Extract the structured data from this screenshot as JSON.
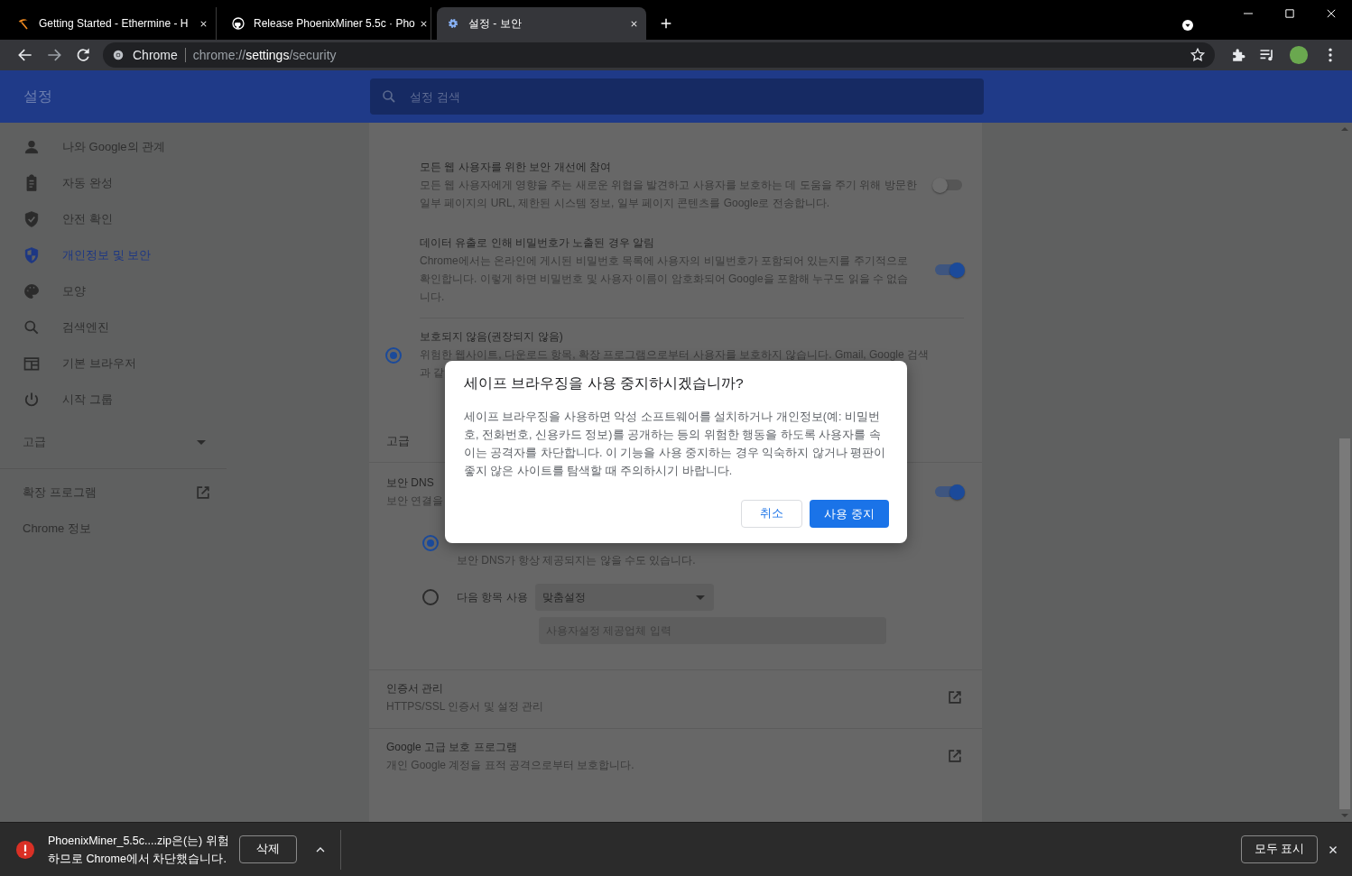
{
  "tabs": [
    {
      "title": "Getting Started - Ethermine - H",
      "selected": false
    },
    {
      "title": "Release PhoenixMiner 5.5c · Pho",
      "selected": false
    },
    {
      "title": "설정 - 보안",
      "selected": true
    }
  ],
  "address_bar": {
    "site_label": "Chrome",
    "url": "chrome://**settings**/security"
  },
  "settings_header": {
    "title": "설정",
    "search_placeholder": "설정 검색"
  },
  "sidebar": {
    "items": [
      {
        "label": "나와 Google의 관계",
        "selected": false
      },
      {
        "label": "자동 완성",
        "selected": false
      },
      {
        "label": "안전 확인",
        "selected": false
      },
      {
        "label": "개인정보 및 보안",
        "selected": true
      },
      {
        "label": "모양",
        "selected": false
      },
      {
        "label": "검색엔진",
        "selected": false
      },
      {
        "label": "기본 브라우저",
        "selected": false
      },
      {
        "label": "시작 그룹",
        "selected": false
      }
    ],
    "advanced": {
      "label": "고급",
      "expanded": false
    },
    "links": [
      {
        "label": "확장 프로그램",
        "external": true
      },
      {
        "label": "Chrome 정보",
        "external": false
      }
    ]
  },
  "settings_rows": [
    {
      "kind": "toggle",
      "title": "모든 웹 사용자를 위한 보안 개선에 참여",
      "description": "모든 웹 사용자에게 영향을 주는 새로운 위협을 발견하고 사용자를 보호하는 데 도움을 주기 위해 방문한 일부 페이지의 URL, 제한된 시스템 정보, 일부 페이지 콘텐츠를 Google로 전송합니다.",
      "on": false
    },
    {
      "kind": "toggle",
      "title": "데이터 유출로 인해 비밀번호가 노출된 경우 알림",
      "description": "Chrome에서는 온라인에 게시된 비밀번호 목록에 사용자의 비밀번호가 포함되어 있는지를 주기적으로 확인합니다. 이렇게 하면 비밀번호 및 사용자 이름이 암호화되어 Google을 포함해 누구도 읽을 수 없습니다.",
      "on": true
    },
    {
      "kind": "radio",
      "title": "보호되지 않음(권장되지 않음)",
      "description": "위험한 웹사이트, 다운로드 항목, 확장 프로그램으로부터 사용자를 보호하지 않습니다. Gmail, Google 검색",
      "description_2": "과 같",
      "selected": true
    }
  ],
  "advanced_heading": "고급",
  "secure_dns": {
    "title": "보안 DNS",
    "description": "보안 연결을",
    "on": true,
    "options": [
      {
        "kind": "note",
        "description": "보안 DNS가 항상 제공되지는 않을 수도 있습니다.",
        "selected": true
      },
      {
        "kind": "custom",
        "label": "다음 항목 사용",
        "select_value": "맞춤설정",
        "input_placeholder": "사용자설정 제공업체 입력",
        "selected": false
      }
    ]
  },
  "link_rows": [
    {
      "title": "인증서 관리",
      "description": "HTTPS/SSL 인증서 및 설정 관리"
    },
    {
      "title": "Google 고급 보호 프로그램",
      "description": "개인 Google 계정을 표적 공격으로부터 보호합니다."
    }
  ],
  "dialog": {
    "title": "세이프 브라우징을 사용 중지하시겠습니까?",
    "body": "세이프 브라우징을 사용하면 악성 소프트웨어를 설치하거나 개인정보(예: 비밀번호, 전화번호, 신용카드 정보)를 공개하는 등의 위험한 행동을 하도록 사용자를 속이는 공격자를 차단합니다. 이 기능을 사용 중지하는 경우 익숙하지 않거나 평판이 좋지 않은 사이트를 탐색할 때 주의하시기 바랍니다.",
    "cancel": "취소",
    "confirm": "사용 중지"
  },
  "download_bar": {
    "message": "PhoenixMiner_5.5c....zip은(는) 위험하므로 Chrome에서 차단했습니다.",
    "delete": "삭제",
    "show_all": "모두 표시"
  }
}
